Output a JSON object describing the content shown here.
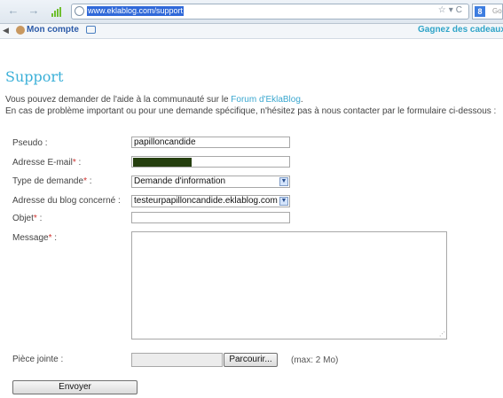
{
  "browser": {
    "url": "www.eklablog.com/support",
    "search_engine": "Go"
  },
  "bookmarks": {
    "account_label": "Mon compte",
    "promo": "Gagnez des cadeaux en"
  },
  "page": {
    "title": "Support",
    "intro_line1_before": "Vous pouvez demander de l'aide à la communauté sur le ",
    "intro_link": "Forum d'EklaBlog",
    "intro_line1_after": ".",
    "intro_line2": "En cas de problème important ou pour une demande spécifique, n'hésitez pas à nous contacter par le formulaire ci-dessous :"
  },
  "form": {
    "pseudo_label": "Pseudo :",
    "pseudo_value": "papilloncandide",
    "email_label": "Adresse E-mail",
    "type_label": "Type de demande",
    "type_value": "Demande d'information",
    "blog_label": "Adresse du blog concerné :",
    "blog_value": "testeurpapilloncandide.eklablog.com",
    "subject_label": "Objet",
    "subject_value": "",
    "message_label": "Message",
    "required_mark": "*",
    "colon": " :",
    "attachment_label": "Pièce jointe :",
    "browse_label": "Parcourir...",
    "max_note": "(max: 2 Mo)",
    "submit_label": "Envoyer"
  }
}
